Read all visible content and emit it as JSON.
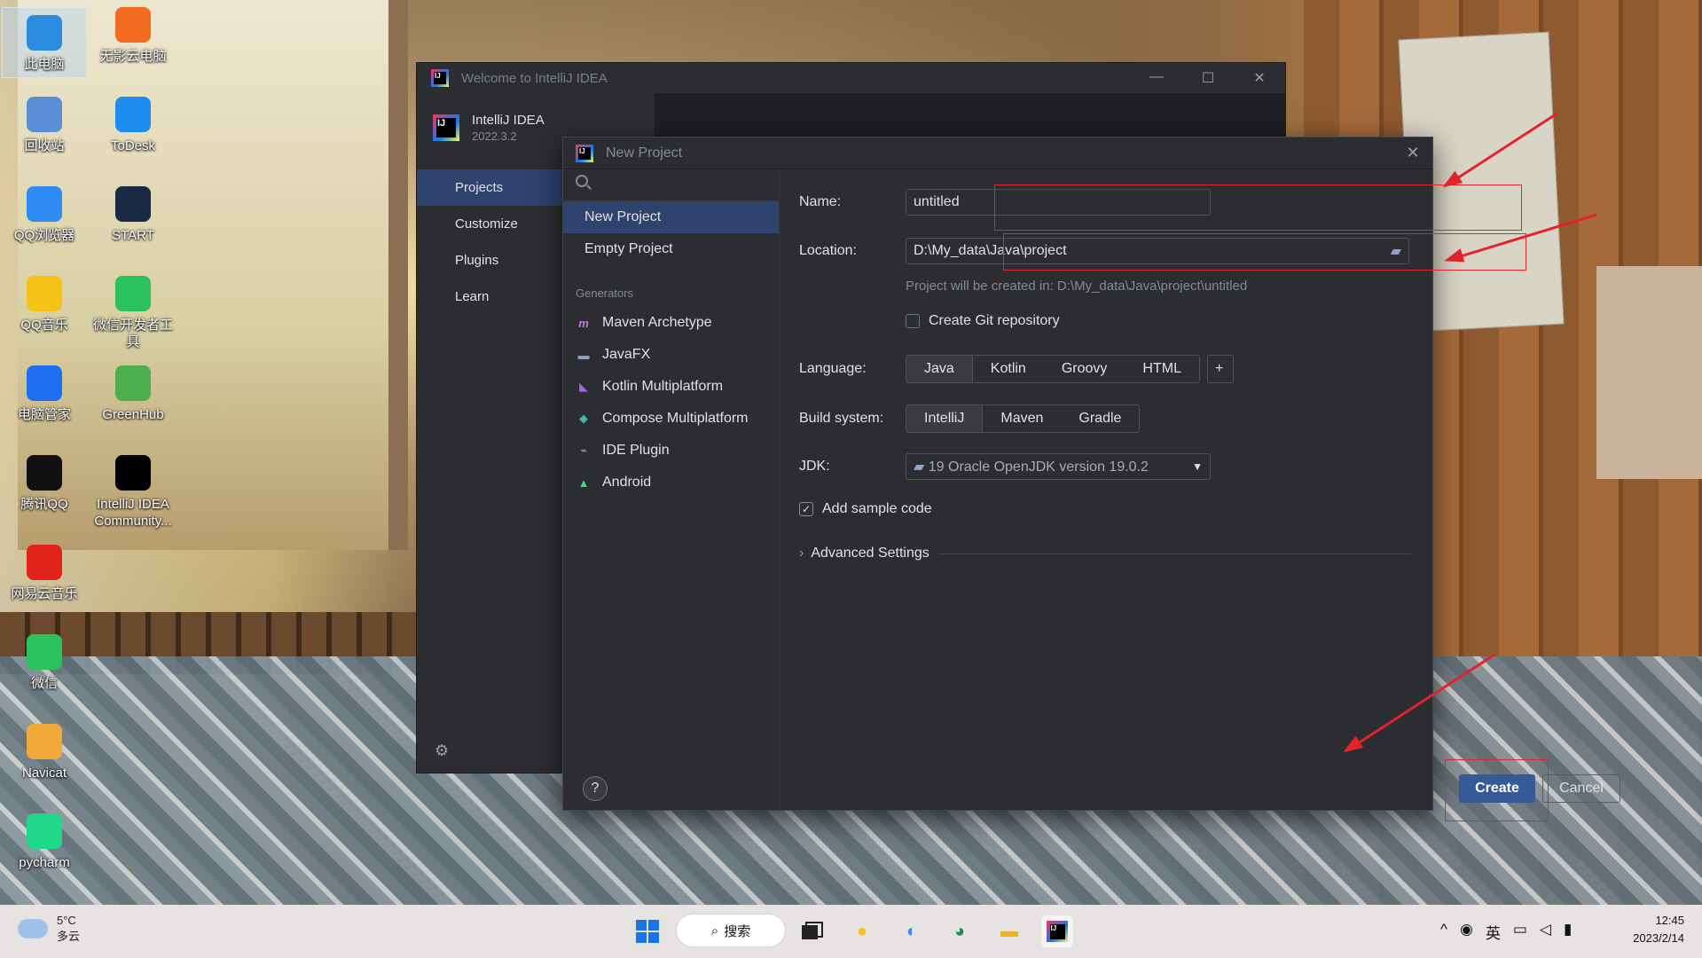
{
  "desktop": {
    "icons": [
      {
        "label": "此电脑",
        "icon": "monitor-icon",
        "color": "#2a8ce0"
      },
      {
        "label": "无影云电脑",
        "icon": "cloud-pc-icon",
        "color": "#f36b21"
      },
      {
        "label": "回收站",
        "icon": "recycle-bin-icon",
        "color": "#5a8fd6"
      },
      {
        "label": "ToDesk",
        "icon": "todesk-icon",
        "color": "#1f8df0"
      },
      {
        "label": "QQ浏览器",
        "icon": "qq-browser-icon",
        "color": "#2f8cf4"
      },
      {
        "label": "START",
        "icon": "start-app-icon",
        "color": "#1a2a44"
      },
      {
        "label": "QQ音乐",
        "icon": "qq-music-icon",
        "color": "#f4c316"
      },
      {
        "label": "微信开发者工具",
        "icon": "wechat-devtools-icon",
        "color": "#2bc15f"
      },
      {
        "label": "电脑管家",
        "icon": "pc-manager-icon",
        "color": "#1e6ff0"
      },
      {
        "label": "GreenHub",
        "icon": "greenhub-icon",
        "color": "#4cae4c"
      },
      {
        "label": "腾讯QQ",
        "icon": "qq-icon",
        "color": "#111111"
      },
      {
        "label": "IntelliJ IDEA Community...",
        "icon": "intellij-icon",
        "color": "#000000"
      },
      {
        "label": "网易云音乐",
        "icon": "netease-music-icon",
        "color": "#e2231a"
      },
      {
        "label": "微信",
        "icon": "wechat-icon",
        "color": "#2bc15f"
      },
      {
        "label": "Navicat",
        "icon": "navicat-icon",
        "color": "#f2a93b"
      },
      {
        "label": "pycharm",
        "icon": "pycharm-icon",
        "color": "#21d789"
      }
    ]
  },
  "welcome": {
    "title": "Welcome to IntelliJ IDEA",
    "product_name": "IntelliJ IDEA",
    "product_version": "2022.3.2",
    "nav": [
      "Projects",
      "Customize",
      "Plugins",
      "Learn"
    ],
    "window_controls": {
      "minimize": "—",
      "maximize": "☐",
      "close": "✕"
    }
  },
  "dialog": {
    "title": "New Project",
    "left_items": [
      "New Project",
      "Empty Project"
    ],
    "generators_header": "Generators",
    "generators": [
      {
        "label": "Maven Archetype",
        "icon": "maven-icon",
        "glyph": "m",
        "color": "#c77ddf"
      },
      {
        "label": "JavaFX",
        "icon": "folder-icon",
        "glyph": "▬",
        "color": "#8da4c6"
      },
      {
        "label": "Kotlin Multiplatform",
        "icon": "kotlin-icon",
        "glyph": "◣",
        "color": "#9b67e8"
      },
      {
        "label": "Compose Multiplatform",
        "icon": "compose-icon",
        "glyph": "◆",
        "color": "#3fb6a8"
      },
      {
        "label": "IDE Plugin",
        "icon": "plug-icon",
        "glyph": "⌁",
        "color": "#9da0a8"
      },
      {
        "label": "Android",
        "icon": "android-icon",
        "glyph": "▲",
        "color": "#3ddc84"
      }
    ],
    "name_label": "Name:",
    "name_value": "untitled",
    "location_label": "Location:",
    "location_value": "D:\\My_data\\Java\\project",
    "location_hint": "Project will be created in: D:\\My_data\\Java\\project\\untitled",
    "git_label": "Create Git repository",
    "language_label": "Language:",
    "languages": [
      "Java",
      "Kotlin",
      "Groovy",
      "HTML"
    ],
    "add_language": "+",
    "build_label": "Build system:",
    "build_systems": [
      "IntelliJ",
      "Maven",
      "Gradle"
    ],
    "jdk_label": "JDK:",
    "jdk_value": "19 Oracle OpenJDK version 19.0.2",
    "sample_code_label": "Add sample code",
    "advanced_label": "Advanced Settings",
    "help": "?",
    "create": "Create",
    "cancel": "Cancel",
    "highlight_color": "#e0262e"
  },
  "taskbar": {
    "temperature": "5°C",
    "weather": "多云",
    "search": "搜索",
    "ime": "英",
    "time": "12:45",
    "date": "2023/2/14"
  }
}
